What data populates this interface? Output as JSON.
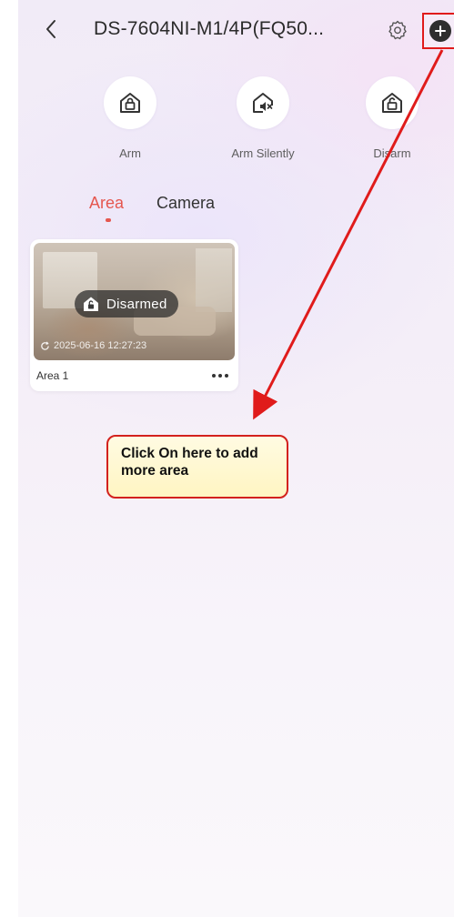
{
  "header": {
    "title": "DS-7604NI-M1/4P(FQ50..."
  },
  "actions": [
    {
      "label": "Arm",
      "icon": "home-lock-icon"
    },
    {
      "label": "Arm Silently",
      "icon": "home-mute-icon"
    },
    {
      "label": "Disarm",
      "icon": "home-unlock-icon"
    }
  ],
  "tabs": [
    {
      "label": "Area",
      "active": true
    },
    {
      "label": "Camera",
      "active": false
    }
  ],
  "area_card": {
    "status": "Disarmed",
    "timestamp": "2025-06-16 12:27:23",
    "name": "Area 1"
  },
  "annotation": {
    "text": "Click On here to add more area",
    "color": "#d3211d"
  },
  "colors": {
    "accent": "#e5574f",
    "annotation_red": "#e01b1b"
  }
}
